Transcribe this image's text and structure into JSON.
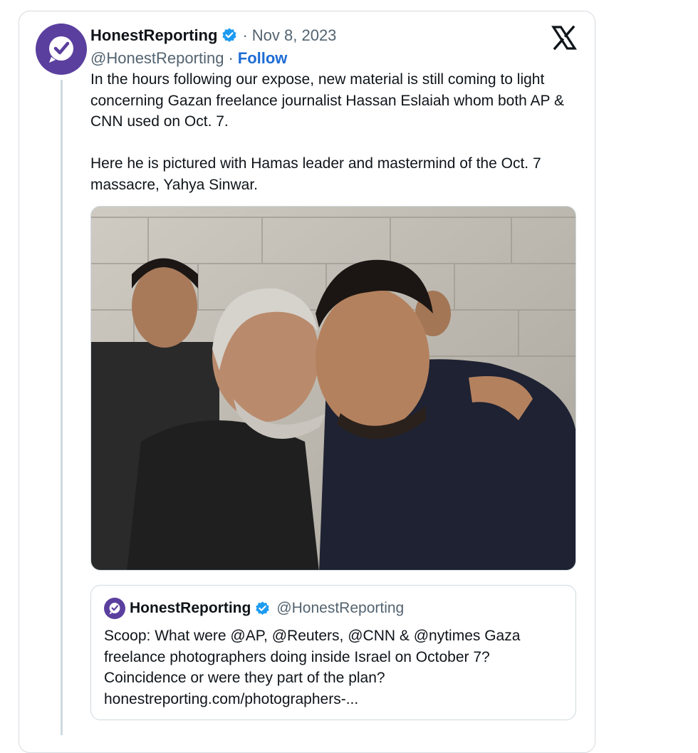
{
  "tweet": {
    "author_name": "HonestReporting",
    "separator": "·",
    "date": "Nov 8, 2023",
    "handle": "@HonestReporting",
    "handle_separator": "·",
    "follow_label": "Follow",
    "text_paragraphs": [
      "In the hours following our expose, new material is still coming to light concerning Gazan freelance journalist Hassan Eslaiah whom both AP & CNN used on Oct. 7.",
      "Here he is pictured with Hamas leader and mastermind of the Oct. 7 massacre, Yahya Sinwar."
    ],
    "platform_icon": "x-logo-icon",
    "avatar_icon": "checkmark-speech-bubble-icon",
    "verified_icon": "verified-badge-icon"
  },
  "quoted_tweet": {
    "author_name": "HonestReporting",
    "handle": "@HonestReporting",
    "text_lines": [
      "Scoop: What were @AP, @Reuters, @CNN & @nytimes Gaza",
      "freelance photographers doing inside Israel on October 7?",
      "Coincidence or were they part of the plan?",
      "honestreporting.com/photographers-..."
    ]
  },
  "colors": {
    "brand_purple": "#5b3f9e",
    "verified_blue": "#1d9bf0",
    "follow_blue": "#1d6cd4",
    "muted_text": "#536471",
    "border": "#cfd9de"
  }
}
